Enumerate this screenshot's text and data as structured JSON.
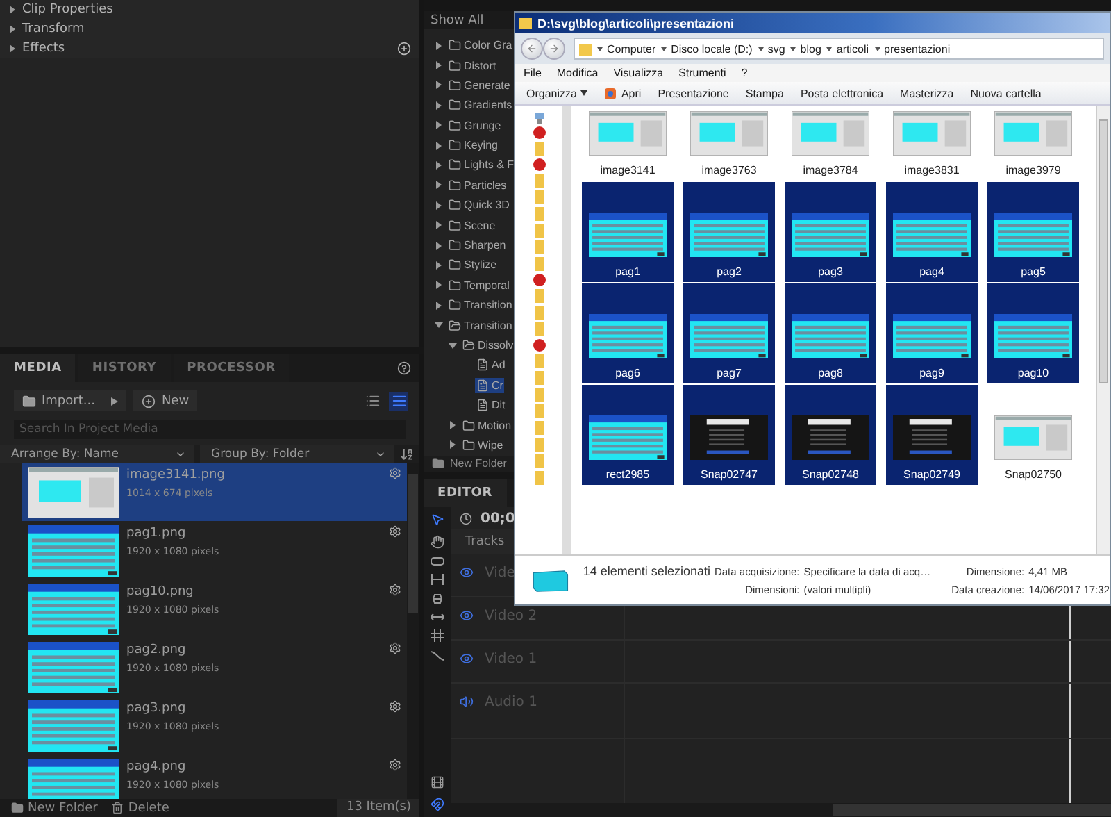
{
  "properties_panel": {
    "sections": [
      {
        "label": "Clip Properties",
        "expanded": false
      },
      {
        "label": "Transform",
        "expanded": false
      },
      {
        "label": "Effects",
        "expanded": false
      }
    ]
  },
  "media_panel": {
    "tabs": [
      {
        "label": "MEDIA",
        "selected": true
      },
      {
        "label": "HISTORY",
        "selected": false
      },
      {
        "label": "PROCESSOR",
        "selected": false
      }
    ],
    "import_button": "Import...",
    "new_button": "New",
    "view_toggles": [
      {
        "kind": "list",
        "selected": false
      },
      {
        "kind": "details",
        "selected": true
      }
    ],
    "search": {
      "placeholder": "Search In Project Media"
    },
    "arrange_by": "Arrange By: Name",
    "group_by": "Group By: Folder",
    "items": [
      {
        "name": "image3141.png",
        "info": "1014 x 674 pixels",
        "kind": "window",
        "selected": true
      },
      {
        "name": "pag1.png",
        "info": "1920 x 1080 pixels",
        "kind": "slide",
        "selected": false
      },
      {
        "name": "pag10.png",
        "info": "1920 x 1080 pixels",
        "kind": "slide",
        "selected": false
      },
      {
        "name": "pag2.png",
        "info": "1920 x 1080 pixels",
        "kind": "slide",
        "selected": false
      },
      {
        "name": "pag3.png",
        "info": "1920 x 1080 pixels",
        "kind": "slide",
        "selected": false
      },
      {
        "name": "pag4.png",
        "info": "1920 x 1080 pixels",
        "kind": "slide",
        "selected": false
      }
    ],
    "footer": {
      "new_folder": "New Folder",
      "delete": "Delete",
      "count": "13 Item(s)"
    }
  },
  "effects_panel": {
    "filter": "Show All",
    "tree": [
      {
        "label": "Color Gra",
        "kind": "folder",
        "expanded": false,
        "selected": false
      },
      {
        "label": "Distort",
        "kind": "folder",
        "expanded": false,
        "selected": false
      },
      {
        "label": "Generate",
        "kind": "folder",
        "expanded": false,
        "selected": false
      },
      {
        "label": "Gradients",
        "kind": "folder",
        "expanded": false,
        "selected": false
      },
      {
        "label": "Grunge",
        "kind": "folder",
        "expanded": false,
        "selected": false
      },
      {
        "label": "Keying",
        "kind": "folder",
        "expanded": false,
        "selected": false
      },
      {
        "label": "Lights & F",
        "kind": "folder",
        "expanded": false,
        "selected": false
      },
      {
        "label": "Particles",
        "kind": "folder",
        "expanded": false,
        "selected": false
      },
      {
        "label": "Quick 3D",
        "kind": "folder",
        "expanded": false,
        "selected": false
      },
      {
        "label": "Scene",
        "kind": "folder",
        "expanded": false,
        "selected": false
      },
      {
        "label": "Sharpen",
        "kind": "folder",
        "expanded": false,
        "selected": false
      },
      {
        "label": "Stylize",
        "kind": "folder",
        "expanded": false,
        "selected": false
      },
      {
        "label": "Temporal",
        "kind": "folder",
        "expanded": false,
        "selected": false
      },
      {
        "label": "Transition",
        "kind": "folder",
        "expanded": false,
        "selected": false
      },
      {
        "label": "Transition",
        "kind": "folder",
        "expanded": true,
        "selected": false,
        "children": [
          {
            "label": "Dissolv",
            "kind": "folder",
            "expanded": true,
            "selected": false,
            "children": [
              {
                "label": "Ad",
                "kind": "effect",
                "selected": false
              },
              {
                "label": "Cr",
                "kind": "effect",
                "selected": true
              },
              {
                "label": "Dit",
                "kind": "effect",
                "selected": false
              }
            ]
          },
          {
            "label": "Motion",
            "kind": "folder",
            "expanded": false,
            "selected": false
          },
          {
            "label": "Wipe",
            "kind": "folder",
            "expanded": false,
            "selected": false
          }
        ]
      }
    ],
    "new_folder": "New Folder"
  },
  "editor": {
    "tab": "EDITOR",
    "timecode": "00;0",
    "tracks_header": "Tracks",
    "tracks": [
      {
        "name": "Vide",
        "kind": "video"
      },
      {
        "name": "Video 2",
        "kind": "video"
      },
      {
        "name": "Video 1",
        "kind": "video"
      },
      {
        "name": "Audio 1",
        "kind": "audio"
      }
    ]
  },
  "explorer": {
    "title": "D:\\svg\\blog\\articoli\\presentazioni",
    "breadcrumbs": [
      "Computer",
      "Disco locale (D:)",
      "svg",
      "blog",
      "articoli",
      "presentazioni"
    ],
    "menu": [
      "File",
      "Modifica",
      "Visualizza",
      "Strumenti",
      "?"
    ],
    "toolbar": [
      {
        "label": "Organizza",
        "kind": "dropdown"
      },
      {
        "label": "Apri",
        "kind": "open"
      },
      {
        "label": "Presentazione",
        "kind": "plain"
      },
      {
        "label": "Stampa",
        "kind": "plain"
      },
      {
        "label": "Posta elettronica",
        "kind": "plain"
      },
      {
        "label": "Masterizza",
        "kind": "plain"
      },
      {
        "label": "Nuova cartella",
        "kind": "plain"
      }
    ],
    "files": [
      {
        "name": "image3141",
        "kind": "window",
        "selected": false
      },
      {
        "name": "image3763",
        "kind": "window",
        "selected": false
      },
      {
        "name": "image3784",
        "kind": "window",
        "selected": false
      },
      {
        "name": "image3831",
        "kind": "window",
        "selected": false
      },
      {
        "name": "image3979",
        "kind": "window",
        "selected": false
      },
      {
        "name": "pag1",
        "kind": "slide",
        "selected": true
      },
      {
        "name": "pag2",
        "kind": "slide",
        "selected": true
      },
      {
        "name": "pag3",
        "kind": "slide",
        "selected": true
      },
      {
        "name": "pag4",
        "kind": "slide",
        "selected": true
      },
      {
        "name": "pag5",
        "kind": "slide",
        "selected": true
      },
      {
        "name": "pag6",
        "kind": "slide",
        "selected": true
      },
      {
        "name": "pag7",
        "kind": "slide",
        "selected": true
      },
      {
        "name": "pag8",
        "kind": "slide",
        "selected": true
      },
      {
        "name": "pag9",
        "kind": "slide",
        "selected": true
      },
      {
        "name": "pag10",
        "kind": "slide",
        "selected": true
      },
      {
        "name": "rect2985",
        "kind": "slide",
        "selected": true
      },
      {
        "name": "Snap02747",
        "kind": "dark",
        "selected": true
      },
      {
        "name": "Snap02748",
        "kind": "dark",
        "selected": true
      },
      {
        "name": "Snap02749",
        "kind": "dark",
        "selected": true
      },
      {
        "name": "Snap02750",
        "kind": "window",
        "selected": false
      }
    ],
    "details": {
      "summary": "14 elementi selezionati",
      "fields": [
        {
          "label": "Data acquisizione:",
          "value": "Specificare la data di acq…"
        },
        {
          "label": "Dimensione:",
          "value": "4,41 MB"
        },
        {
          "label": "Dimensioni:",
          "value": "(valori multipli)"
        },
        {
          "label": "Data creazione:",
          "value": "14/06/2017 17:32"
        }
      ]
    }
  }
}
